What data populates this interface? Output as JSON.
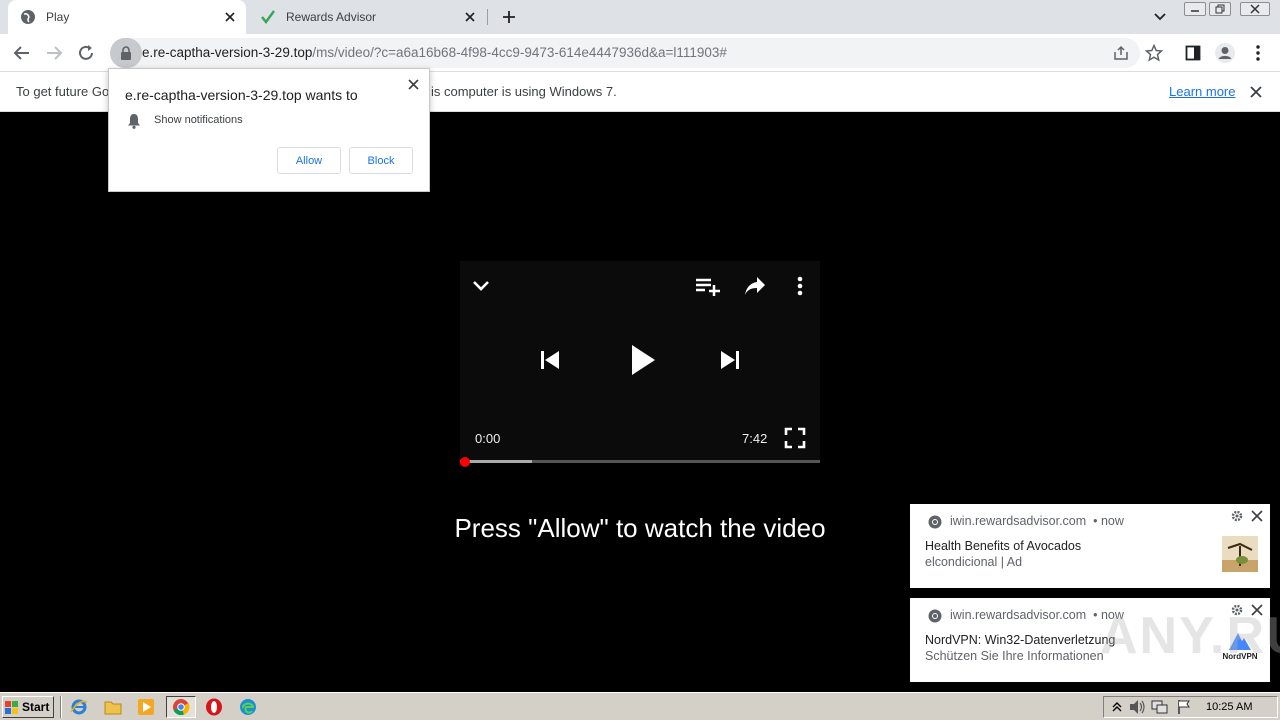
{
  "tabs": [
    {
      "label": "Play",
      "icon": "globe-icon"
    },
    {
      "label": "Rewards Advisor",
      "icon": "green-check-icon"
    }
  ],
  "address": {
    "host": "e.re-captha-version-3-29.top",
    "path": "/ms/video/?c=a6a16b68-4f98-4cc9-9473-614e4447936d&a=l111903#"
  },
  "infobar": {
    "text_left": "To get future Go",
    "text_right": "is computer is using Windows 7.",
    "learn_more": "Learn more"
  },
  "permission": {
    "title": "e.re-captha-version-3-29.top wants to",
    "row": "Show notifications",
    "allow": "Allow",
    "block": "Block"
  },
  "player": {
    "time_current": "0:00",
    "time_duration": "7:42",
    "progress_played": 0.0,
    "progress_buffered": 0.2
  },
  "caption": "Press \"Allow\" to watch the video",
  "notifications": [
    {
      "source": "iwin.rewardsadvisor.com",
      "when": "• now",
      "title": "Health Benefits of Avocados",
      "subtitle": "elcondicional | Ad"
    },
    {
      "source": "iwin.rewardsadvisor.com",
      "when": "• now",
      "title": "NordVPN: Win32-Datenverletzung",
      "subtitle": "Schützen Sie Ihre Informationen",
      "logo_text": "NordVPN"
    }
  ],
  "taskbar": {
    "start": "Start",
    "clock": "10:25 AM"
  },
  "watermark": "ANY.RUN",
  "colors": {
    "accent": "#1a73e8",
    "progress": "#ff0000"
  }
}
